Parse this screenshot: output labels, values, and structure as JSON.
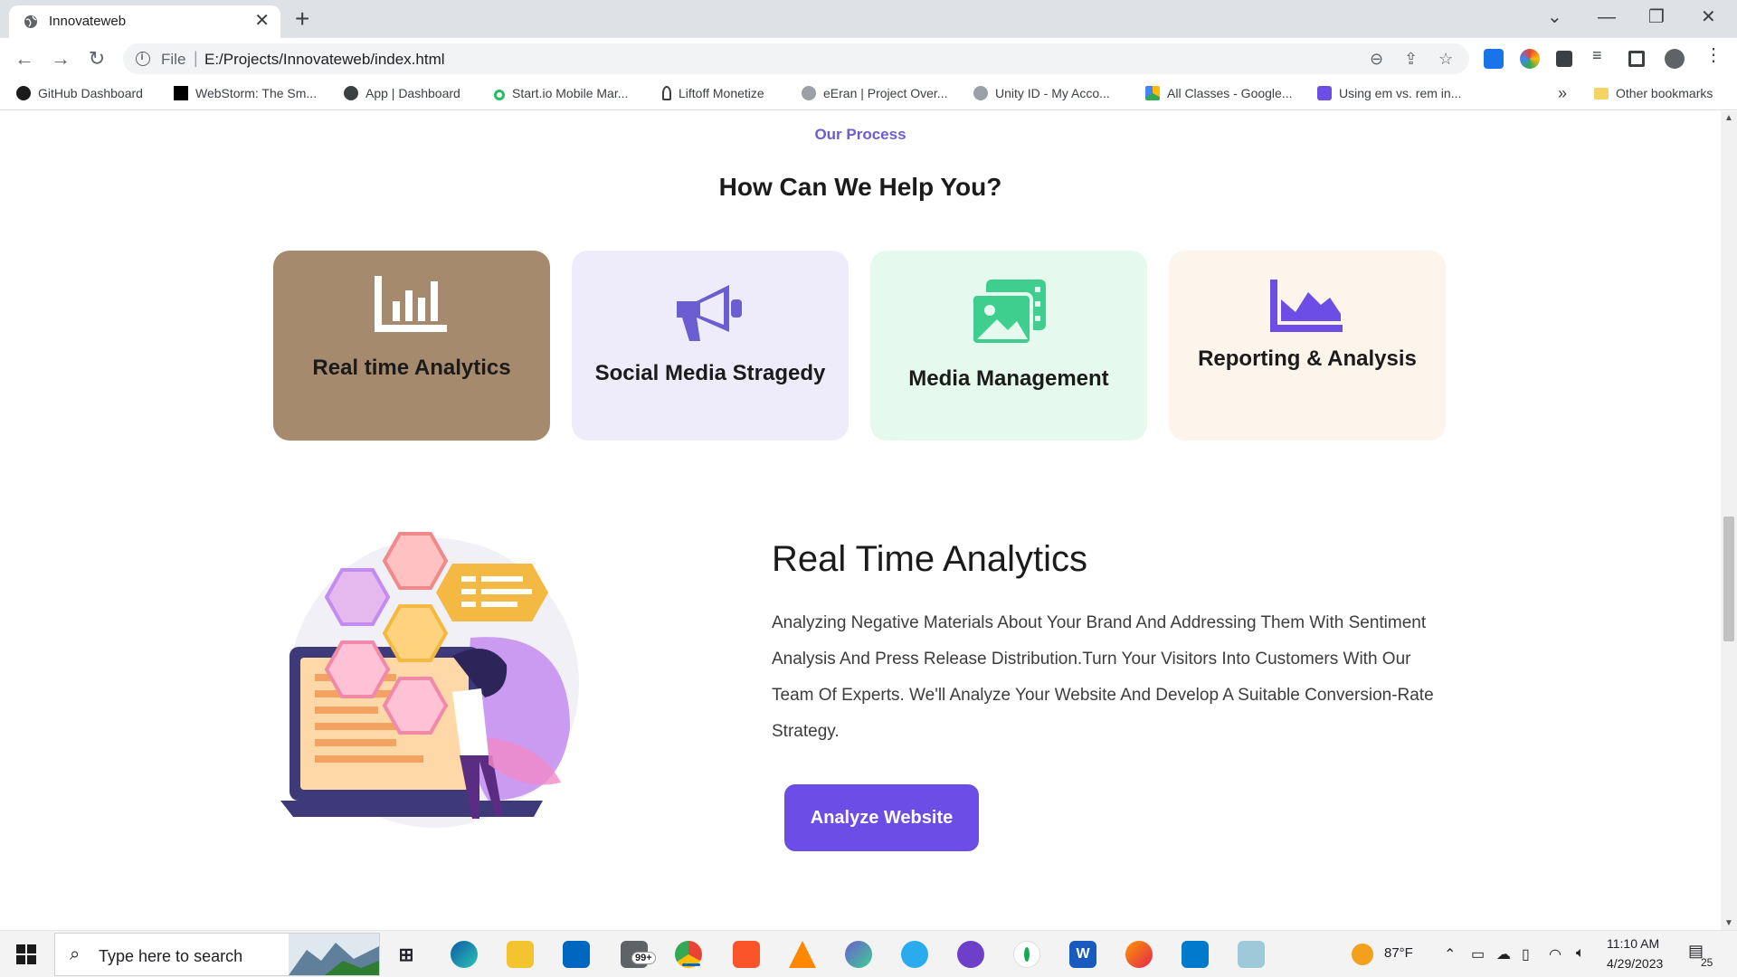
{
  "browser": {
    "tab_title": "Innovateweb",
    "url_scheme": "File",
    "url": "E:/Projects/Innovateweb/index.html",
    "bookmarks": [
      {
        "label": "GitHub Dashboard",
        "icon": "github-icon"
      },
      {
        "label": "WebStorm: The Sm...",
        "icon": "webstorm-icon"
      },
      {
        "label": "App | Dashboard",
        "icon": "globe-icon"
      },
      {
        "label": "Start.io Mobile Mar...",
        "icon": "startio-icon"
      },
      {
        "label": "Liftoff Monetize",
        "icon": "liftoff-icon"
      },
      {
        "label": "eEran | Project Over...",
        "icon": "unity-icon"
      },
      {
        "label": "Unity ID - My Acco...",
        "icon": "unity-icon"
      },
      {
        "label": "All Classes - Google...",
        "icon": "google-drive-icon"
      },
      {
        "label": "Using em vs. rem in...",
        "icon": "bookmark-a-icon"
      }
    ],
    "more_bookmarks": "»",
    "other_bookmarks": "Other bookmarks"
  },
  "page": {
    "eyebrow": "Our Process",
    "heading": "How Can We Help You?",
    "cards": [
      {
        "label": "Real time Analytics",
        "icon": "bar-chart-icon",
        "bg": "#a68a6d",
        "icon_color": "#ffffff"
      },
      {
        "label": "Social Media Stragedy",
        "icon": "megaphone-icon",
        "bg": "#eeecfb",
        "icon_color": "#6c5dd3"
      },
      {
        "label": "Media Management",
        "icon": "images-icon",
        "bg": "#e6f9ef",
        "icon_color": "#3ecf8e"
      },
      {
        "label": "Reporting & Analysis",
        "icon": "area-chart-icon",
        "bg": "#fdf4ec",
        "icon_color": "#6c4ee6"
      }
    ],
    "feature": {
      "title": "Real Time Analytics",
      "description": "Analyzing Negative Materials About Your Brand And Addressing Them With Sentiment Analysis And Press Release Distribution.Turn Your Visitors Into Customers With Our Team Of Experts. We'll Analyze Your Website And Develop A Suitable Conversion-Rate Strategy.",
      "button": "Analyze Website"
    },
    "accent": "#6c4ee6"
  },
  "taskbar": {
    "search_placeholder": "Type here to search",
    "mail_badge": "99+",
    "weather": "87°F",
    "time": "11:10 AM",
    "date": "4/29/2023",
    "notifications": "25"
  }
}
